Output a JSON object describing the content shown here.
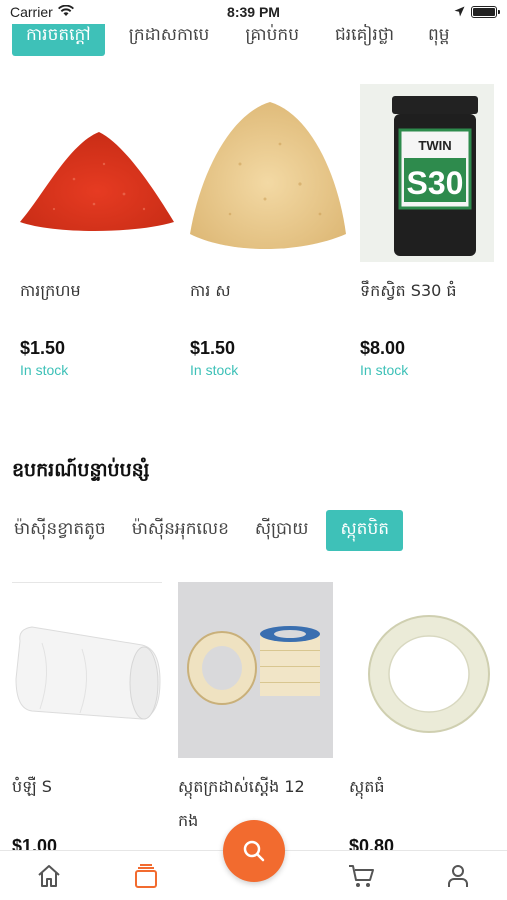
{
  "status_bar": {
    "carrier": "Carrier",
    "time": "8:39 PM"
  },
  "top_tabs": [
    {
      "label": "ការចតក្តៅ",
      "active": true
    },
    {
      "label": "ក្រដាសកាបេ",
      "active": false
    },
    {
      "label": "គ្រាប់កប",
      "active": false
    },
    {
      "label": "ជរគៀរថ្លា",
      "active": false
    },
    {
      "label": "ពុម្ព",
      "active": false
    }
  ],
  "products_top": [
    {
      "name": "ការក្រហម",
      "price": "$1.50",
      "stock": "In stock",
      "image": "red-granules"
    },
    {
      "name": "ការ ស",
      "price": "$1.50",
      "stock": "In stock",
      "image": "beige-granules"
    },
    {
      "name": "ទឹកស្វិត S30 ធំ",
      "price": "$8.00",
      "stock": "In stock",
      "image": "black-jar-s30"
    }
  ],
  "section": {
    "title": "ឧបករណ៍បន្ទាប់បន្សំ",
    "sub_tabs": [
      {
        "label": "ម៉ាស៊ីនខ្វាតតូច",
        "active": false
      },
      {
        "label": "ម៉ាស៊ីនអុកលេខ",
        "active": false
      },
      {
        "label": "ស៊ីប្រាយ",
        "active": false
      },
      {
        "label": "ស្កុតបិត",
        "active": true
      }
    ]
  },
  "products_bottom": [
    {
      "name": "បំឡឺ S",
      "price": "$1.00",
      "image": "white-roll"
    },
    {
      "name": "ស្កុតក្រដាស់ស្តើង 12",
      "name2": "កង",
      "price": "",
      "image": "masking-tape-rolls"
    },
    {
      "name": "ស្កុតធំ",
      "price": "$0.80",
      "image": "clear-tape-roll"
    }
  ],
  "bottom_nav": {
    "items": [
      "home-icon",
      "catalog-icon",
      "search-icon",
      "cart-icon",
      "account-icon"
    ],
    "active_color": "#f26b2f",
    "fab_color": "#f26b2f"
  },
  "accent_color": "#3ec1b8"
}
